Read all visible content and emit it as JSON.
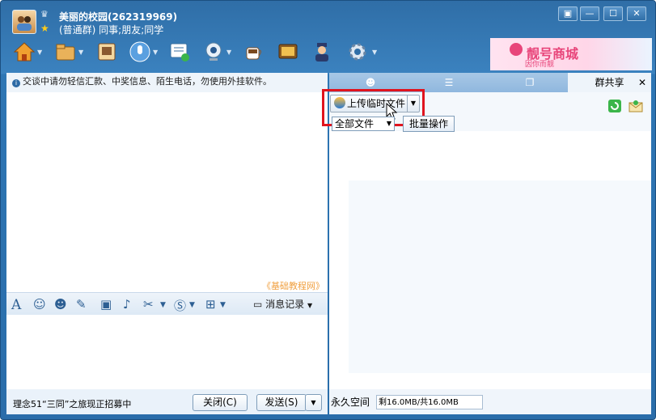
{
  "window": {
    "group_name": "美丽的校园(262319969)",
    "group_meta": "(普通群) 同事;朋友;同学"
  },
  "window_controls": [
    "▣",
    "—",
    "☐",
    "✕"
  ],
  "ad": {
    "brand": "靓号商城",
    "slogan": "因你而靓"
  },
  "chat": {
    "notice": "交谈中请勿轻信汇款、中奖信息、陌生电话，勿使用外挂软件。",
    "watermark": "《基础教程网》",
    "history_label": "消息记录",
    "promo": "理念51“三同”之旅现正招募中",
    "close_label": "关闭(C)",
    "send_label": "发送(S)"
  },
  "share_panel": {
    "tab_active_label": "群共享",
    "upload_label": "上传临时文件",
    "filter_selected": "全部文件",
    "batch_label": "批量操作",
    "space_label": "永久空间",
    "quota_text": "剩16.0MB/共16.0MB"
  },
  "icons": {
    "toolbar": [
      "home-icon",
      "folder-icon",
      "album-icon",
      "voice-icon",
      "share-screen-icon",
      "webcam-icon",
      "coffee-icon",
      "tv-icon",
      "police-icon",
      "gear-icon"
    ],
    "format": [
      "font-icon",
      "smiley-icon",
      "face-icon",
      "edit-icon",
      "picture-icon",
      "music-icon",
      "scissors-icon",
      "stamp-icon",
      "more-icon"
    ]
  }
}
